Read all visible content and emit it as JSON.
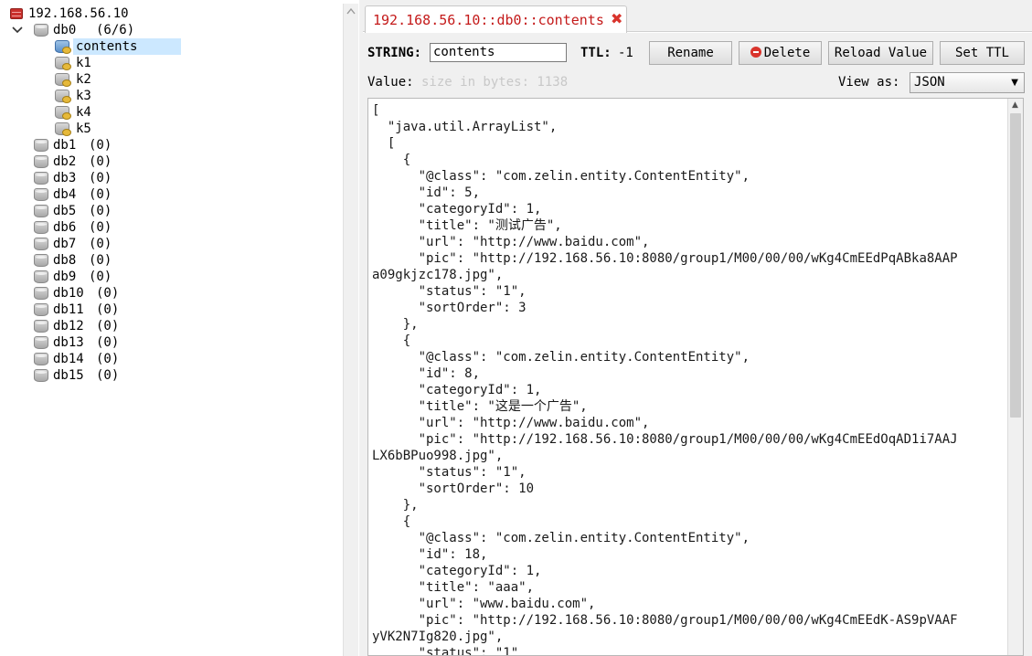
{
  "tree": {
    "server": "192.168.56.10",
    "db0": {
      "name": "db0",
      "count": "(6/6)"
    },
    "keys": [
      "contents",
      "k1",
      "k2",
      "k3",
      "k4",
      "k5"
    ],
    "selected_key": "contents",
    "dbs": [
      {
        "name": "db1",
        "count": "(0)"
      },
      {
        "name": "db2",
        "count": "(0)"
      },
      {
        "name": "db3",
        "count": "(0)"
      },
      {
        "name": "db4",
        "count": "(0)"
      },
      {
        "name": "db5",
        "count": "(0)"
      },
      {
        "name": "db6",
        "count": "(0)"
      },
      {
        "name": "db7",
        "count": "(0)"
      },
      {
        "name": "db8",
        "count": "(0)"
      },
      {
        "name": "db9",
        "count": "(0)"
      },
      {
        "name": "db10",
        "count": "(0)"
      },
      {
        "name": "db11",
        "count": "(0)"
      },
      {
        "name": "db12",
        "count": "(0)"
      },
      {
        "name": "db13",
        "count": "(0)"
      },
      {
        "name": "db14",
        "count": "(0)"
      },
      {
        "name": "db15",
        "count": "(0)"
      }
    ]
  },
  "tab": {
    "title": "192.168.56.10::db0::contents",
    "close": "✖"
  },
  "key_panel": {
    "type_label": "STRING:",
    "key_value": "contents",
    "ttl_label": "TTL:",
    "ttl_value": "-1",
    "rename_label": "Rename",
    "delete_label": "Delete",
    "reload_label": "Reload Value",
    "setttl_label": "Set TTL",
    "value_label": "Value:",
    "size_hint": "size in bytes: 1138",
    "view_as_label": "View as:",
    "view_as_value": "JSON"
  },
  "value_text": "[\n  \"java.util.ArrayList\",\n  [\n    {\n      \"@class\": \"com.zelin.entity.ContentEntity\",\n      \"id\": 5,\n      \"categoryId\": 1,\n      \"title\": \"测试广告\",\n      \"url\": \"http://www.baidu.com\",\n      \"pic\": \"http://192.168.56.10:8080/group1/M00/00/00/wKg4CmEEdPqABka8AAP\na09gkjzc178.jpg\",\n      \"status\": \"1\",\n      \"sortOrder\": 3\n    },\n    {\n      \"@class\": \"com.zelin.entity.ContentEntity\",\n      \"id\": 8,\n      \"categoryId\": 1,\n      \"title\": \"这是一个广告\",\n      \"url\": \"http://www.baidu.com\",\n      \"pic\": \"http://192.168.56.10:8080/group1/M00/00/00/wKg4CmEEdOqAD1i7AAJ\nLX6bBPuo998.jpg\",\n      \"status\": \"1\",\n      \"sortOrder\": 10\n    },\n    {\n      \"@class\": \"com.zelin.entity.ContentEntity\",\n      \"id\": 18,\n      \"categoryId\": 1,\n      \"title\": \"aaa\",\n      \"url\": \"www.baidu.com\",\n      \"pic\": \"http://192.168.56.10:8080/group1/M00/00/00/wKg4CmEEdK-AS9pVAAF\nyVK2N7Ig820.jpg\",\n      \"status\": \"1\"",
  "colors": {
    "tab_title": "#c41a1a",
    "selection": "#cce8ff",
    "delete_icon": "#d9342c"
  }
}
